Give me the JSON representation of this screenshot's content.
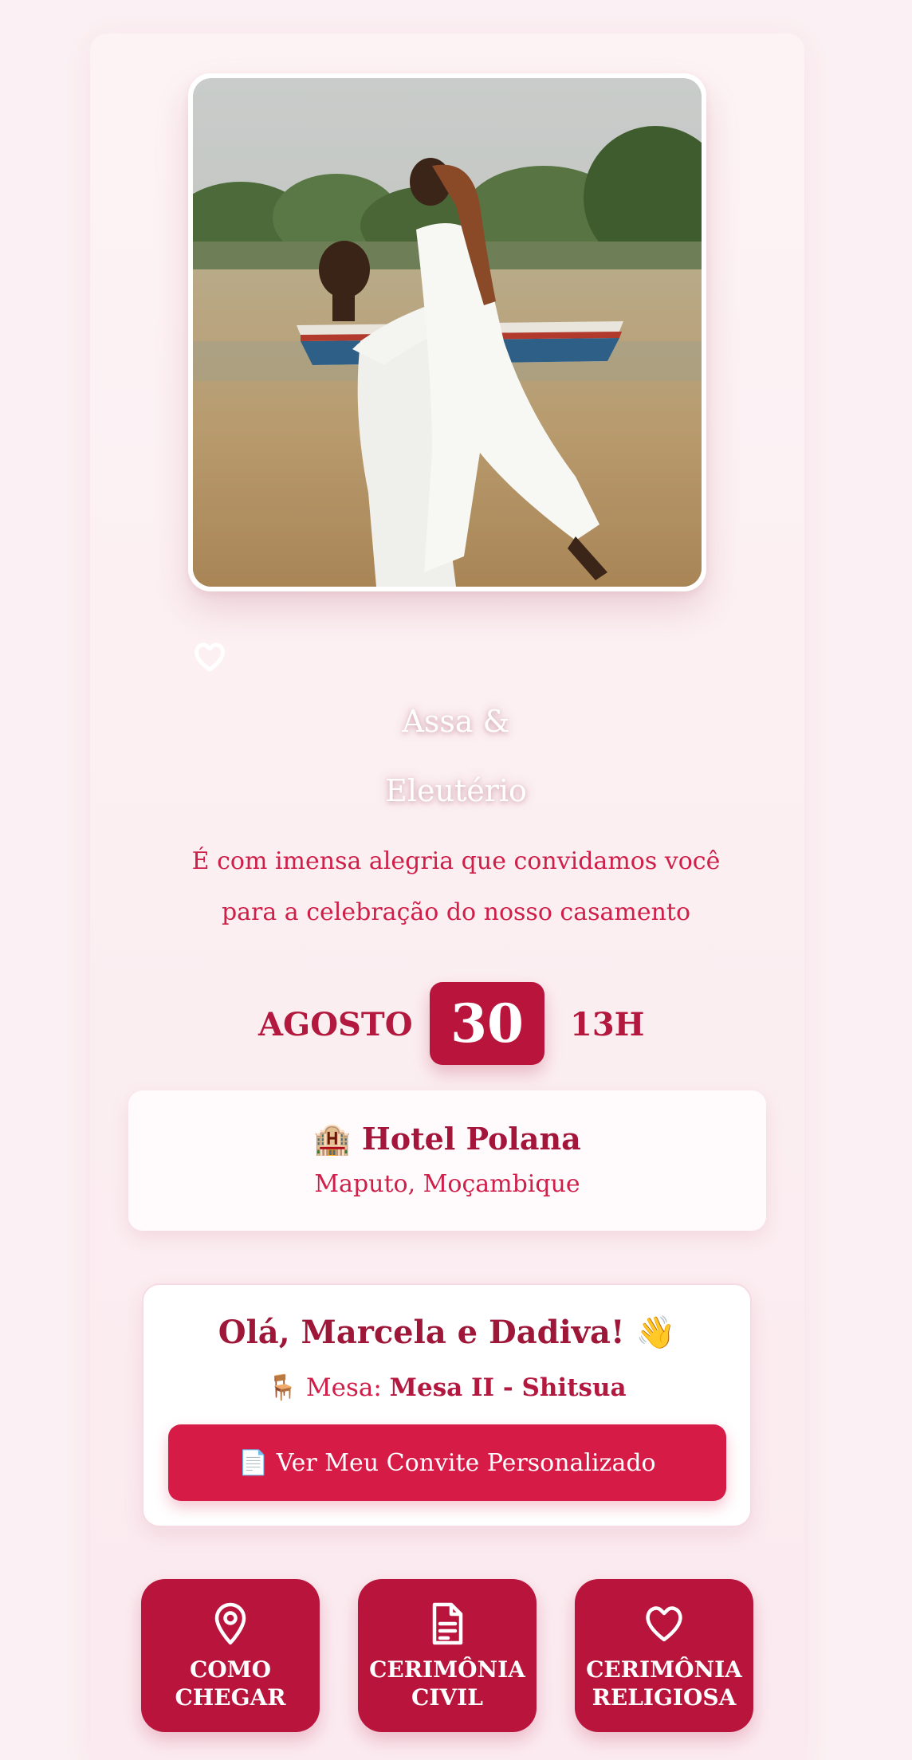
{
  "couple": {
    "name_line1": "Assa &",
    "name_line2": "Eleutério"
  },
  "intro": {
    "line1": "É com imensa alegria que convidamos você",
    "line2": "para a celebração do nosso casamento"
  },
  "date": {
    "month": "AGOSTO",
    "day": "30",
    "time": "13H"
  },
  "venue": {
    "icon": "🏨",
    "name": "Hotel Polana",
    "city": "Maputo, Moçambique"
  },
  "guest": {
    "greeting": "Olá, Marcela e Dadiva! 👋",
    "table_icon": "🪑",
    "table_label": "Mesa:",
    "table_value": "Mesa II - Shitsua",
    "button_icon": "📄",
    "button_label": "Ver Meu Convite Personalizado"
  },
  "actions": [
    {
      "label": "COMO\nCHEGAR",
      "icon": "map-pin-icon"
    },
    {
      "label": "CERIMÔNIA\nCIVIL",
      "icon": "document-icon"
    },
    {
      "label": "CERIMÔNIA\nRELIGIOSA",
      "icon": "heart-icon"
    }
  ],
  "colors": {
    "primary": "#b8143c",
    "accent": "#d71b47",
    "text_rose": "#cf1f49",
    "background": "#fbf0f3"
  }
}
